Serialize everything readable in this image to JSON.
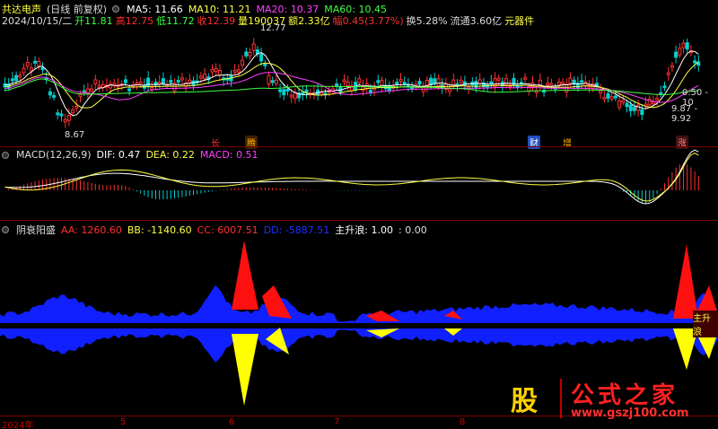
{
  "header": {
    "stock_title": "共达电声",
    "period": "(日线 前复权)",
    "ma5": "MA5: 11.66",
    "ma10": "MA10: 11.21",
    "ma20": "MA20: 10.37",
    "ma60": "MA60: 10.45",
    "date": "2024/10/15/二",
    "open": "开11.81",
    "high": "高12.75",
    "low": "低11.72",
    "close": "收12.39",
    "volume": "量190037",
    "amount": "额2.33亿",
    "change": "幅0.45(3.77%)",
    "turnover": "换5.28%",
    "float_cap": "流通3.60亿",
    "unit": "元器件"
  },
  "price_annotations": {
    "high_label": "12.77",
    "low_label": "8.67",
    "right_a": "0.50 - 10",
    "right_b": "9.87 - 9.92"
  },
  "badges": [
    {
      "text": "长",
      "color": "#ff3030"
    },
    {
      "text": "腾",
      "color": "#ffb000"
    },
    {
      "text": "财",
      "color": "#ffffff"
    },
    {
      "text": "增",
      "color": "#ffb000"
    },
    {
      "text": "涨",
      "color": "#ff8080"
    }
  ],
  "macd": {
    "title": "MACD(12,26,9)",
    "dif": "DIF: 0.47",
    "dea": "DEA: 0.22",
    "macd": "MACD: 0.51"
  },
  "indicator": {
    "title": "阴衰阳盛",
    "aa": "AA: 1260.60",
    "bb": "BB: -1140.60",
    "cc": "CC: 6007.51",
    "dd": "DD: -5887.51",
    "main": "主升浪: 1.00",
    "extra": ": 0.00",
    "tag": "主升浪"
  },
  "axis_labels": [
    "2024年",
    "5",
    "6",
    "7",
    "8"
  ],
  "logo": {
    "char": "股",
    "title": "公式之家",
    "url": "www.gszj100.com"
  },
  "colors": {
    "up": "#ff3030",
    "down": "#00d0d0",
    "ma5": "#ffffff",
    "ma10": "#ffff40",
    "ma20": "#ff40ff",
    "ma60": "#40ff40",
    "blue": "#1020ff",
    "yellow": "#ffff00",
    "red": "#ff1010"
  }
}
